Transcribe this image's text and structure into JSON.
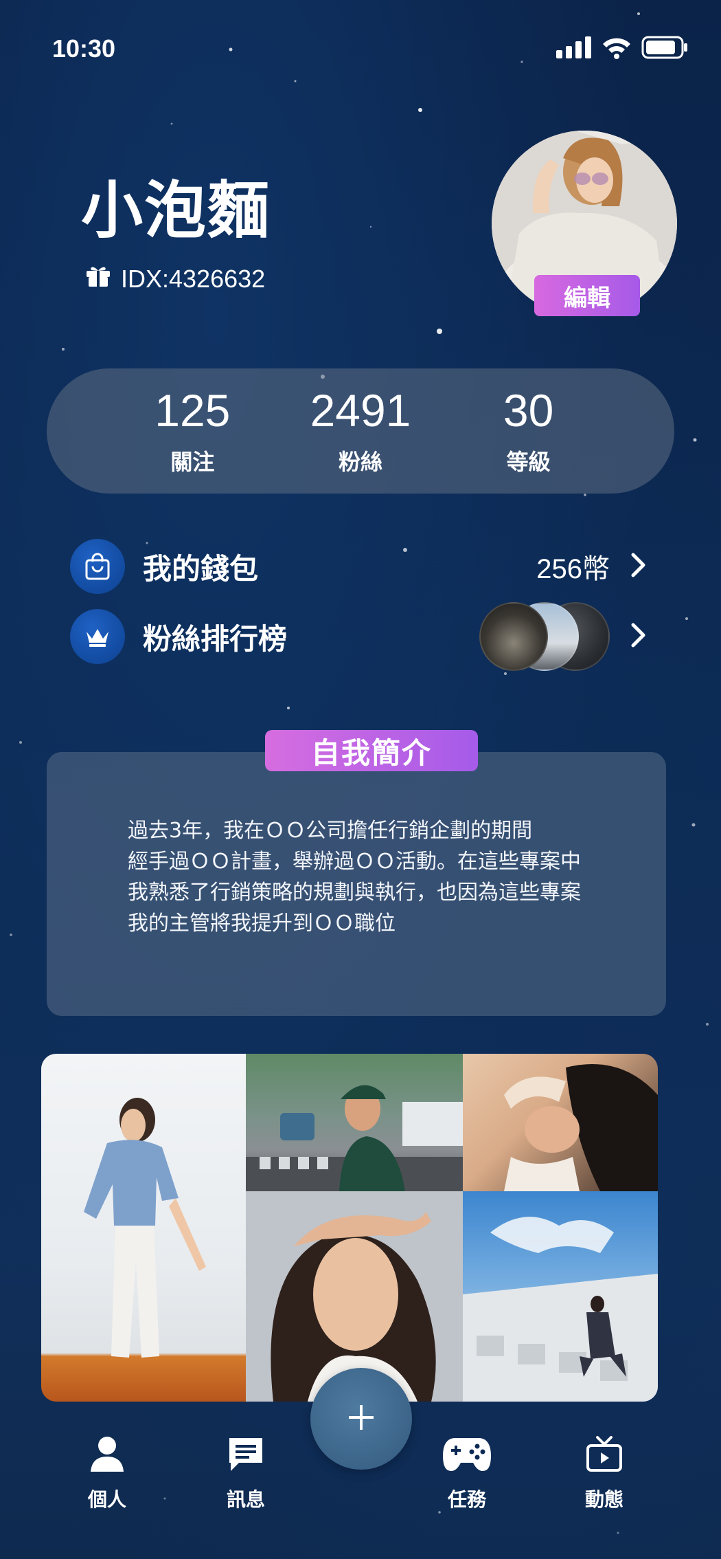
{
  "status_bar": {
    "time": "10:30",
    "icons": [
      "signal-icon",
      "wifi-icon",
      "battery-icon"
    ]
  },
  "profile": {
    "name": "小泡麵",
    "id_text": "IDX:4326632",
    "edit_label": "編輯"
  },
  "stats": [
    {
      "value": "125",
      "label": "關注"
    },
    {
      "value": "2491",
      "label": "粉絲"
    },
    {
      "value": "30",
      "label": "等級"
    }
  ],
  "menu": {
    "wallet": {
      "label": "我的錢包",
      "value": "256幣",
      "icon": "shopping-bag-icon"
    },
    "fan_ranking": {
      "label": "粉絲排行榜",
      "icon": "crown-icon"
    }
  },
  "bio": {
    "title": "自我簡介",
    "lines": [
      "過去3年，我在ＯＯ公司擔任行銷企劃的期間",
      "經手過ＯＯ計畫，舉辦過ＯＯ活動。在這些專案中",
      "我熟悉了行銷策略的規劃與執行，也因為這些專案",
      "我的主管將我提升到ＯＯ職位"
    ]
  },
  "tab_bar": {
    "items": [
      {
        "label": "個人",
        "icon": "person-icon"
      },
      {
        "label": "訊息",
        "icon": "message-icon"
      },
      {
        "label": "任務",
        "icon": "gamepad-icon"
      },
      {
        "label": "動態",
        "icon": "tv-icon"
      }
    ],
    "fab_icon": "plus-icon"
  },
  "colors": {
    "accent_gradient_start": "#d66de0",
    "accent_gradient_end": "#a55be9",
    "icon_blue": "#124ba0",
    "background": "#0c2a54"
  }
}
